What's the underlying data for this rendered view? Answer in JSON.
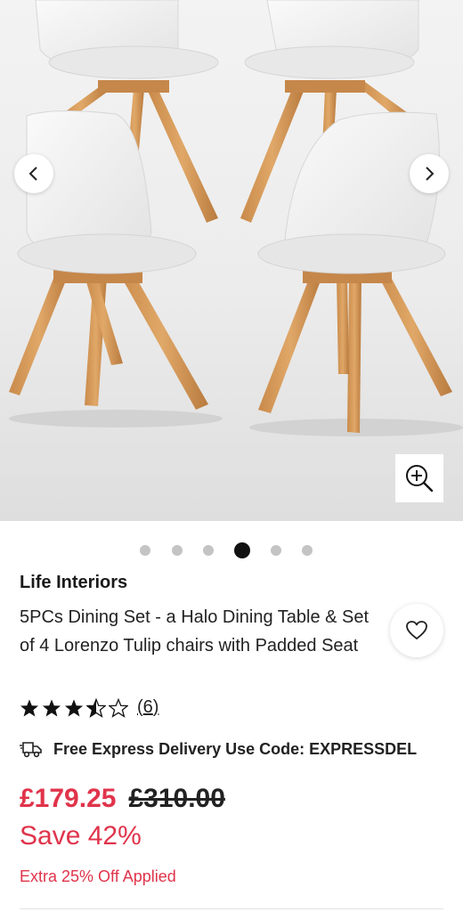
{
  "gallery": {
    "image_alt": "Four white Lorenzo Tulip chairs with wooden legs",
    "prev_icon": "chevron-left-icon",
    "next_icon": "chevron-right-icon",
    "zoom_icon": "zoom-in-icon",
    "dot_count": 6,
    "active_dot": 4
  },
  "product": {
    "brand": "Life Interiors",
    "title": "5PCs Dining Set - a Halo Dining Table & Set of 4 Lorenzo Tulip chairs with Padded Seat",
    "wishlist_icon": "heart-icon",
    "rating": 3.5,
    "rating_max": 5,
    "rating_count": "6",
    "delivery_icon": "delivery-truck-icon",
    "delivery_text": "Free Express Delivery Use Code: EXPRESSDEL",
    "price_now": "£179.25",
    "price_was": "£310.00",
    "save_text": "Save 42%",
    "extra_offer": "Extra 25% Off Applied"
  },
  "colors": {
    "sale_red": "#e0344b",
    "text_dark": "#1a1a1a",
    "dot_inactive": "#c4c4c4",
    "dot_active": "#111111"
  }
}
